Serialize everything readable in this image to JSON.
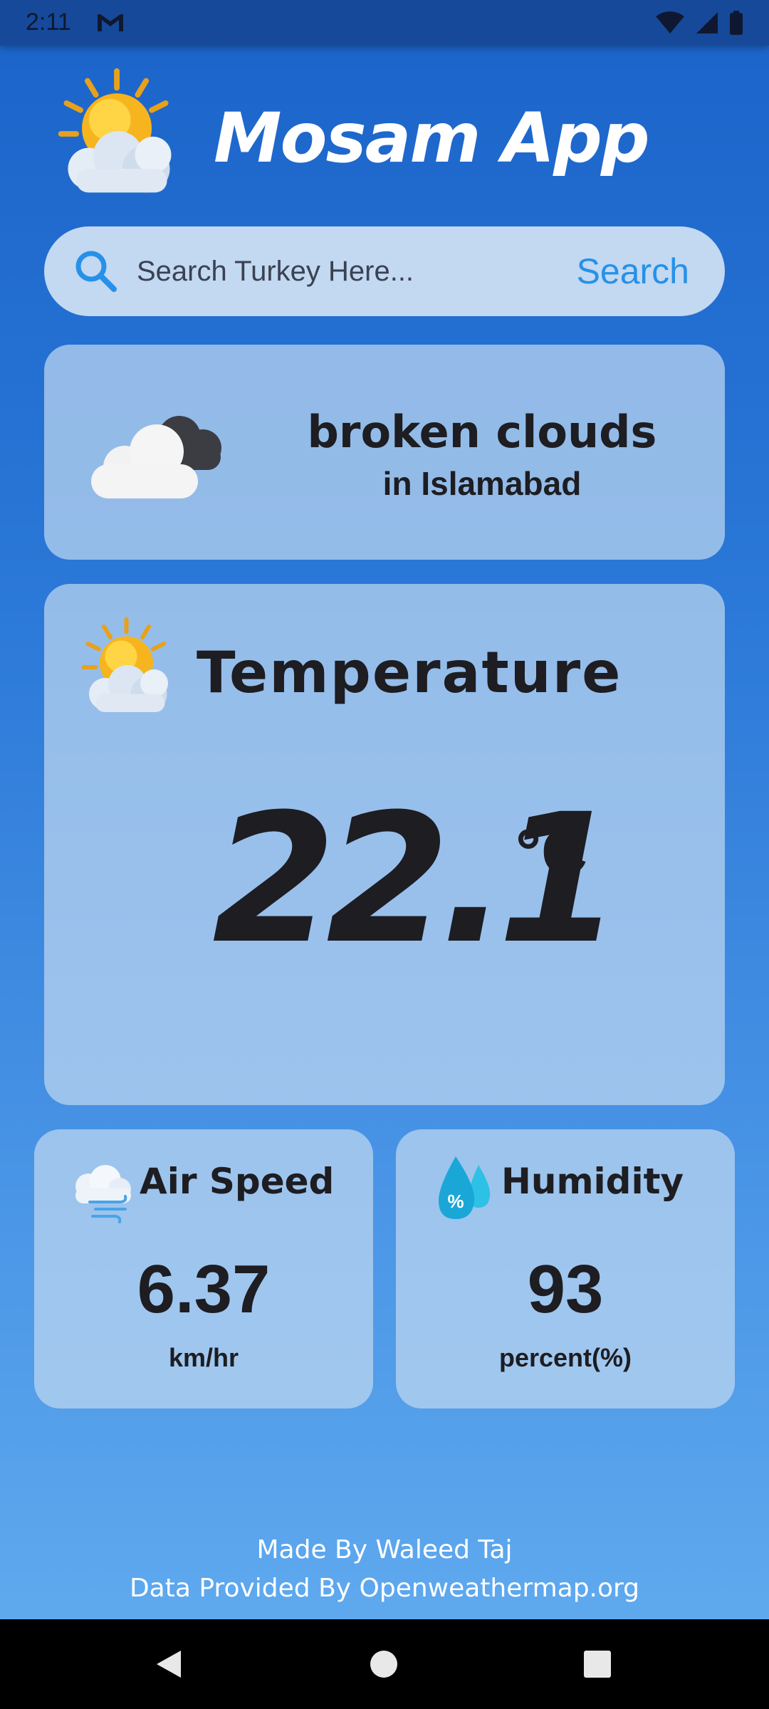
{
  "status_bar": {
    "time": "2:11",
    "notification_icon": "gmail-icon",
    "icons": [
      "wifi-icon",
      "signal-icon",
      "battery-icon"
    ]
  },
  "header": {
    "logo_icon": "sun-cloud-icon",
    "title": "Mosam App"
  },
  "search": {
    "icon": "search-icon",
    "placeholder": "Search Turkey Here...",
    "value": "",
    "button_label": "Search"
  },
  "condition": {
    "icon": "broken-clouds-icon",
    "description": "broken clouds",
    "location": "in Islamabad"
  },
  "temperature": {
    "icon": "sun-cloud-icon",
    "title": "Temperature",
    "value": "22.1",
    "unit": "°C"
  },
  "air_speed": {
    "icon": "wind-cloud-icon",
    "title": "Air Speed",
    "value": "6.37",
    "unit": "km/hr"
  },
  "humidity": {
    "icon": "humidity-drop-icon",
    "title": "Humidity",
    "value": "93",
    "unit": "percent(%)"
  },
  "footer": {
    "line1": "Made By Waleed Taj",
    "line2": "Data Provided By Openweathermap.org"
  },
  "nav_bar": {
    "buttons": [
      "back-icon",
      "home-icon",
      "recents-icon"
    ]
  },
  "colors": {
    "accent": "#2691e8",
    "status_bar": "#16499a",
    "card": "#bed7f0",
    "text_dark": "#1d1d22"
  }
}
